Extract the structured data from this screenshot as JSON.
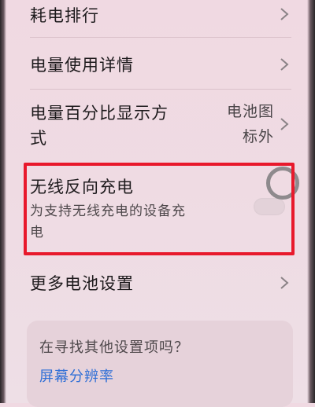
{
  "rows": {
    "power_ranking": {
      "label": "耗电排行"
    },
    "usage_details": {
      "label": "电量使用详情"
    },
    "percentage_display": {
      "label_line1": "电量百分比显示方",
      "label_line2": "式",
      "value_line1": "电池图",
      "value_line2": "标外"
    },
    "reverse_charging": {
      "label": "无线反向充电",
      "subtitle_line1": "为支持无线充电的设备充",
      "subtitle_line2": "电",
      "enabled": false
    },
    "more_battery": {
      "label": "更多电池设置"
    }
  },
  "suggestions": {
    "question": "在寻找其他设置项吗？",
    "link": "屏幕分辨率"
  },
  "colors": {
    "highlight": "#e8192c",
    "link": "#2f6fd6"
  }
}
